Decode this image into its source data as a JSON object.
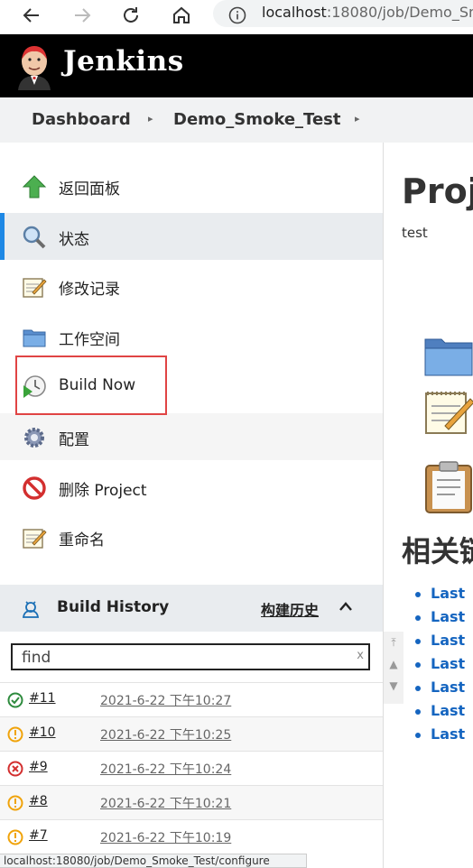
{
  "browser": {
    "url_host": "localhost",
    "url_path": ":18080/job/Demo_Sm"
  },
  "header": {
    "app_name": "Jenkins"
  },
  "breadcrumb": {
    "items": [
      "Dashboard",
      "Demo_Smoke_Test"
    ]
  },
  "sidebar": {
    "items": [
      {
        "label": "返回面板",
        "icon": "up-arrow-icon"
      },
      {
        "label": "状态",
        "icon": "search-icon"
      },
      {
        "label": "修改记录",
        "icon": "notepad-icon"
      },
      {
        "label": "工作空间",
        "icon": "folder-icon"
      },
      {
        "label": "Build Now",
        "icon": "build-clock-icon"
      },
      {
        "label": "配置",
        "icon": "gear-icon"
      },
      {
        "label": "删除 Project",
        "icon": "no-entry-icon"
      },
      {
        "label": "重命名",
        "icon": "notepad-icon"
      }
    ]
  },
  "build_history": {
    "title": "Build History",
    "trend_label": "构建历史",
    "search_value": "find",
    "clear_label": "x",
    "builds": [
      {
        "number": "#11",
        "time": "2021-6-22 下午10:27",
        "status": "success",
        "status_color": "#2e8b3e"
      },
      {
        "number": "#10",
        "time": "2021-6-22 下午10:25",
        "status": "unstable",
        "status_color": "#f0a30a"
      },
      {
        "number": "#9",
        "time": "2021-6-22 下午10:24",
        "status": "failure",
        "status_color": "#d32f2f"
      },
      {
        "number": "#8",
        "time": "2021-6-22 下午10:21",
        "status": "unstable",
        "status_color": "#f0a30a"
      },
      {
        "number": "#7",
        "time": "2021-6-22 下午10:19",
        "status": "unstable",
        "status_color": "#f0a30a"
      }
    ]
  },
  "statusbar": {
    "text": "localhost:18080/job/Demo_Smoke_Test/configure"
  },
  "main": {
    "title": "Proje",
    "description": "test",
    "related_title": "相关链",
    "last_links": [
      "Last",
      "Last",
      "Last",
      "Last",
      "Last",
      "Last",
      "Last"
    ]
  }
}
